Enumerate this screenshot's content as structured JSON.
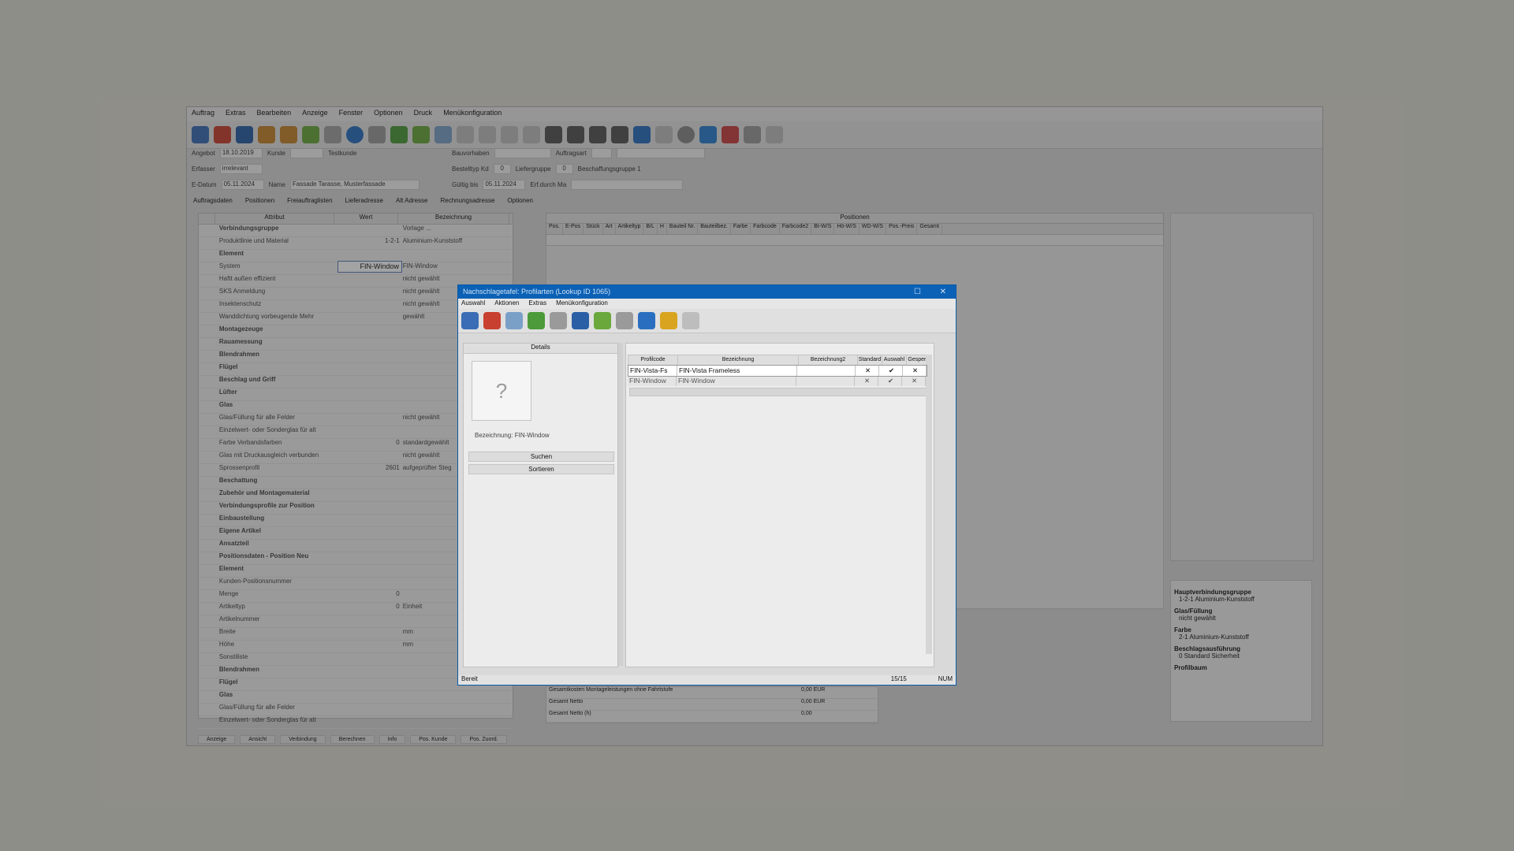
{
  "main_app": {
    "menu": [
      "Auftrag",
      "Extras",
      "Bearbeiten",
      "Anzeige",
      "Fenster",
      "Optionen",
      "Druck",
      "Menükonfiguration"
    ],
    "header_fields": {
      "angebot_label": "Angebot",
      "angebot_value": "18.10.2019",
      "kunde_label": "Kunde",
      "kunde_value": "Testkunde",
      "erfasser_label": "Erfasser",
      "erfasser_value": "irrelevant",
      "datum_label": "E-Datum",
      "datum_value": "05.11.2024",
      "name_label": "Name",
      "name_value": "Fassade Tarasse, Musterfassade",
      "bauvorhaben_label": "Bauvorhaben",
      "bestelltiger_label": "Bestelltyp Kd",
      "bestelltiger_value": "0",
      "gueltig_label": "Gültig bis",
      "gueltig_value": "05.11.2024",
      "auftragsart_label": "Auftragsart",
      "lieferzeit_label": "Liefergruppe",
      "lieferzeit_value": "0",
      "erf_durch_label": "Erf.durch Ma",
      "beschaffung_label": "Beschaffungsgruppe 1"
    },
    "tabs": [
      "Auftragsdaten",
      "Positionen",
      "Freiauftraglisten",
      "Lieferadresse",
      "Alt Adresse",
      "Rechnungsadresse",
      "Optionen"
    ],
    "left_panel": {
      "columns": [
        "Attribut",
        "Wert",
        "Bezeichnung"
      ],
      "rows": [
        {
          "attr": "Verbindungsgruppe",
          "val": "",
          "desc": "Vorlage ...",
          "bold": true
        },
        {
          "attr": "Produktlinie und Material",
          "val": "1-2-1",
          "desc": "Aluminium-Kunststoff",
          "bold": false
        },
        {
          "attr": "Element",
          "val": "",
          "desc": "",
          "bold": true
        },
        {
          "attr": "System",
          "val": "",
          "desc": "FIN-Window",
          "bold": false
        },
        {
          "attr": "Haftt außen effizient",
          "val": "",
          "desc": "nicht gewählt",
          "bold": false
        },
        {
          "attr": "SKS Anmeldung",
          "val": "",
          "desc": "nicht gewählt",
          "bold": false
        },
        {
          "attr": "Insektenschutz",
          "val": "",
          "desc": "nicht gewählt",
          "bold": false
        },
        {
          "attr": "Wanddichtung vorbeugende Mehr",
          "val": "",
          "desc": "gewählt",
          "bold": false
        },
        {
          "attr": "Montagezeuge",
          "val": "",
          "desc": "",
          "bold": true
        },
        {
          "attr": "Rauamessung",
          "val": "",
          "desc": "",
          "bold": true
        },
        {
          "attr": "Blendrahmen",
          "val": "",
          "desc": "",
          "bold": true
        },
        {
          "attr": "Flügel",
          "val": "",
          "desc": "",
          "bold": true
        },
        {
          "attr": "Beschlag und Griff",
          "val": "",
          "desc": "",
          "bold": true
        },
        {
          "attr": "Lüfter",
          "val": "",
          "desc": "",
          "bold": true
        },
        {
          "attr": "Glas",
          "val": "",
          "desc": "",
          "bold": true
        },
        {
          "attr": "Glas/Füllung für alle Felder",
          "val": "",
          "desc": "nicht gewählt",
          "bold": false
        },
        {
          "attr": "Einzelwert- oder Sonderglas für alt",
          "val": "",
          "desc": "",
          "bold": false
        },
        {
          "attr": "Farbe Verbandsfarben",
          "val": "0",
          "desc": "standardgewählt",
          "bold": false
        },
        {
          "attr": "Glas mit Druckausgleich verbunden",
          "val": "",
          "desc": "nicht gewählt",
          "bold": false
        },
        {
          "attr": "Sprossenprofil",
          "val": "2601",
          "desc": "aufgeprüfter Steg",
          "bold": false
        },
        {
          "attr": "Beschattung",
          "val": "",
          "desc": "",
          "bold": true
        },
        {
          "attr": "Zubehör und Montagematerial",
          "val": "",
          "desc": "",
          "bold": true
        },
        {
          "attr": "Verbindungsprofile zur Position",
          "val": "",
          "desc": "",
          "bold": true
        },
        {
          "attr": "Einbaustellung",
          "val": "",
          "desc": "",
          "bold": true
        },
        {
          "attr": "Eigene Artikel",
          "val": "",
          "desc": "",
          "bold": true
        },
        {
          "attr": "Ansatzteil",
          "val": "",
          "desc": "",
          "bold": true
        },
        {
          "attr": "Positionsdaten - Position Neu",
          "val": "",
          "desc": "",
          "bold": true
        },
        {
          "attr": "Element",
          "val": "",
          "desc": "",
          "bold": true
        },
        {
          "attr": "Kunden-Positionsnummer",
          "val": "",
          "desc": "",
          "bold": false
        },
        {
          "attr": "Menge",
          "val": "0",
          "desc": "",
          "bold": false
        },
        {
          "attr": "Artikeltyp",
          "val": "0",
          "desc": "Einheit",
          "bold": false
        },
        {
          "attr": "Artikelnummer",
          "val": "",
          "desc": "",
          "bold": false
        },
        {
          "attr": "Breite",
          "val": "",
          "desc": "mm",
          "bold": false
        },
        {
          "attr": "Höhe",
          "val": "",
          "desc": "mm",
          "bold": false
        },
        {
          "attr": "Sonstiliste",
          "val": "",
          "desc": "",
          "bold": false
        },
        {
          "attr": "Blendrahmen",
          "val": "",
          "desc": "",
          "bold": true
        },
        {
          "attr": "Flügel",
          "val": "",
          "desc": "",
          "bold": true
        },
        {
          "attr": "Glas",
          "val": "",
          "desc": "",
          "bold": true
        },
        {
          "attr": "Glas/Füllung für alle Felder",
          "val": "",
          "desc": "",
          "bold": false
        },
        {
          "attr": "Einzelwert- oder Sonderglas für alt",
          "val": "",
          "desc": "",
          "bold": false
        }
      ],
      "system_field_value": "FIN-Window"
    },
    "positions_panel": {
      "title": "Positionen",
      "columns": [
        "Pos.",
        "E-Pos",
        "Stück",
        "Art",
        "Artikeltyp",
        "B/L",
        "H",
        "Bauteil Nr.",
        "Bauteilbez.",
        "Farbe",
        "Farbcode",
        "Farbcode2",
        "BI-W/S",
        "Hö-W/S",
        "WD-W/S",
        "Pos.-Preis",
        "Gesamt"
      ]
    },
    "summary": [
      {
        "label": "Gesamtkosten Montageleistungen ohne Fahrtstufe",
        "value": "0,00 EUR"
      },
      {
        "label": "Gesamt Netto",
        "value": "0,00 EUR"
      },
      {
        "label": "Gesamt Netto (h)",
        "value": "0,00"
      }
    ],
    "right_info": [
      {
        "label": "Hauptverbindungsgruppe",
        "value": "1-2-1 Aluminium-Kunststoff"
      },
      {
        "label": "Glas/Füllung",
        "value": "nicht gewählt"
      },
      {
        "label": "Farbe",
        "value": "2-1 Aluminium-Kunststoff"
      },
      {
        "label": "Beschlagsausführung",
        "value": "0 Standard Sicherheit"
      },
      {
        "label": "Profilbaum",
        "value": ""
      }
    ],
    "bottom_tabs": [
      "Anzeige",
      "Ansicht",
      "Verbindung",
      "Berechnen",
      "Info",
      "Pos. Kunde",
      "Pos. Zuord."
    ]
  },
  "dialog": {
    "title": "Nachschlagetafel: Profilarten (Lookup ID 1065)",
    "menu": [
      "Auswahl",
      "Aktionen",
      "Extras",
      "Menükonfiguration"
    ],
    "left_header": "Details",
    "image_placeholder": "?",
    "bezeichnung_text": "Bezeichnung: FIN-Window",
    "btn_suchen": "Suchen",
    "btn_sortieren": "Sortieren",
    "grid_columns": [
      "Profilcode",
      "Bezeichnung",
      "Bezeichnung2",
      "Standard",
      "Auswahl",
      "Gesperrt"
    ],
    "rows": [
      {
        "code": "FIN-Vista-Fs",
        "name": "FIN-Vista Frameless",
        "name2": "",
        "c1": "✕",
        "c2": "✔",
        "c3": "✕",
        "selected": true
      },
      {
        "code": "FIN-Window",
        "name": "FIN-Window",
        "name2": "",
        "c1": "✕",
        "c2": "✔",
        "c3": "✕",
        "selected": false
      }
    ],
    "status_left": "Bereit",
    "status_mid": "15/15",
    "status_right": "NUM"
  }
}
